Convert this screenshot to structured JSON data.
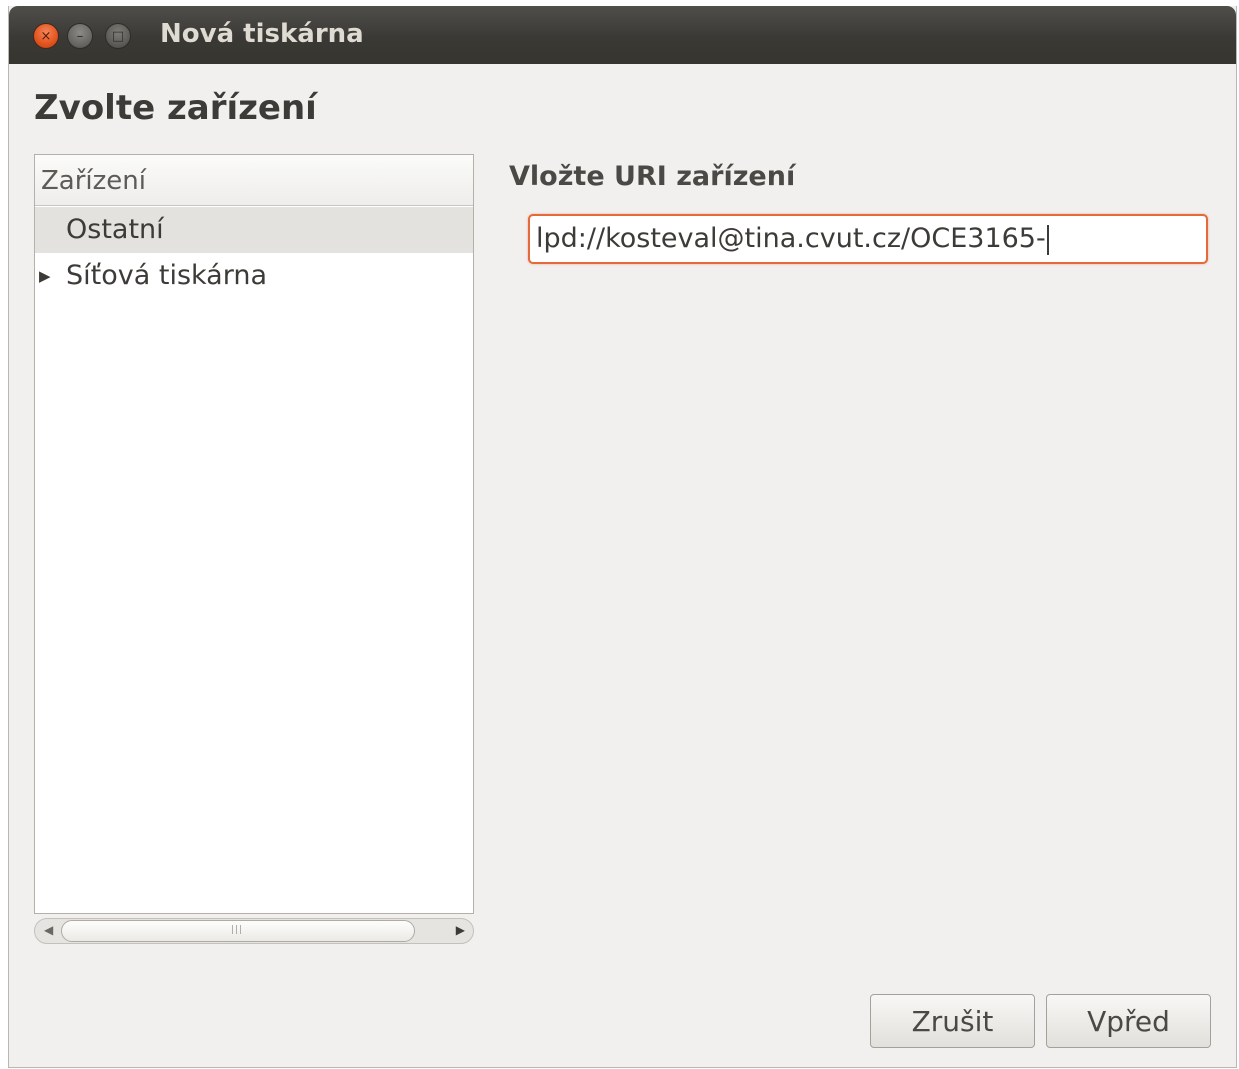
{
  "window": {
    "title": "Nová tiskárna",
    "controls": {
      "close_glyph": "×",
      "minimize_glyph": "–",
      "maximize_glyph": "□"
    }
  },
  "page": {
    "heading": "Zvolte zařízení"
  },
  "device_tree": {
    "column_header": "Zařízení",
    "items": [
      {
        "label": "Ostatní",
        "selected": true,
        "expandable": false
      },
      {
        "label": "Síťová tiskárna",
        "selected": false,
        "expandable": true,
        "expander_glyph": "▶"
      }
    ],
    "scrollbar": {
      "left_arrow": "◀",
      "right_arrow": "▶",
      "grip": "|||"
    }
  },
  "uri": {
    "label": "Vložte URI zařízení",
    "value": "lpd://kosteval@tina.cvut.cz/OCE3165-"
  },
  "buttons": {
    "cancel": "Zrušit",
    "forward": "Vpřed"
  },
  "colors": {
    "titlebar": "#3c3b37",
    "dialog_background": "#f1f0ee",
    "selection": "#e4e2de",
    "focus_border": "#e4693b",
    "close_button": "#e2531e"
  }
}
